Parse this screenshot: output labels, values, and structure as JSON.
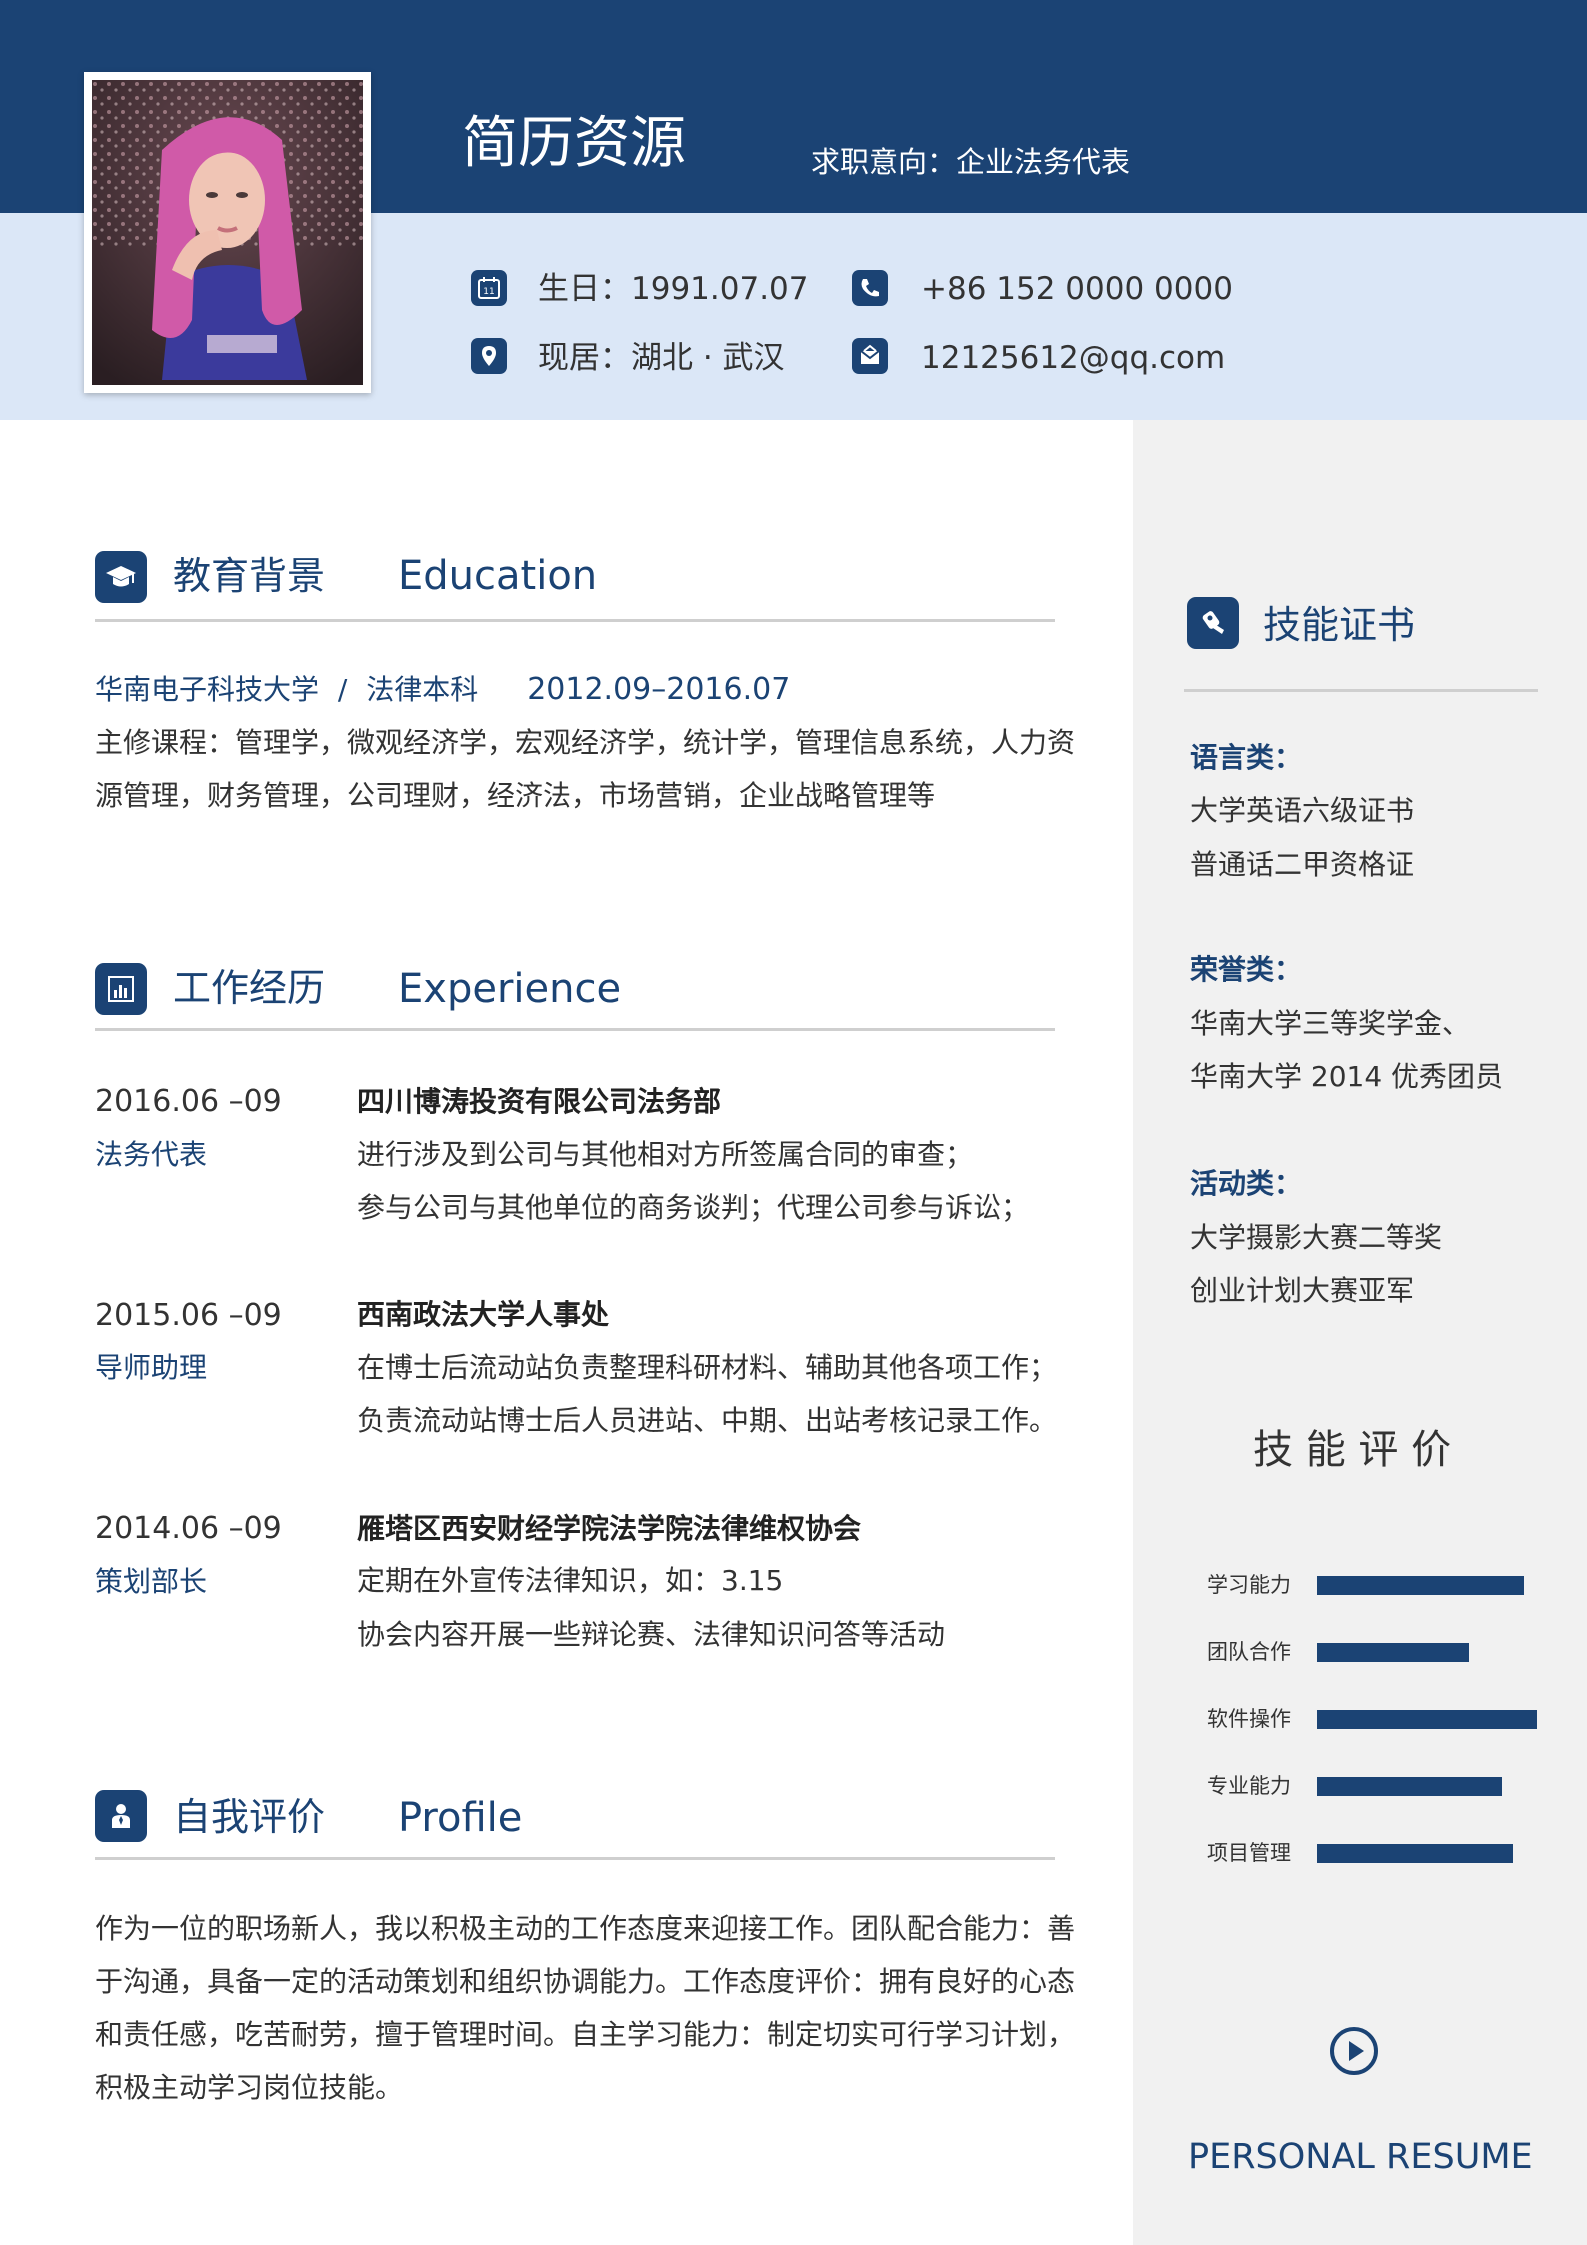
{
  "header": {
    "name": "简历资源",
    "intent": "求职意向：企业法务代表",
    "contacts": {
      "birthday": "生日：1991.07.07",
      "phone": "+86 152 0000 0000",
      "residence": "现居：湖北 · 武汉",
      "email": "12125612@qq.com"
    },
    "calendar_day": "11"
  },
  "education": {
    "title_zh": "教育背景",
    "title_en": "Education",
    "school": "华南电子科技大学",
    "separator": "/",
    "major": "法律本科",
    "period": "2012.09–2016.07",
    "courses_line1": "主修课程：管理学，微观经济学，宏观经济学，统计学，管理信息系统，人力资",
    "courses_line2": "源管理，财务管理，公司理财，经济法，市场营销，企业战略管理等"
  },
  "experience": {
    "title_zh": "工作经历",
    "title_en": "Experience",
    "items": [
      {
        "date": "2016.06 –09",
        "role": "法务代表",
        "org": "四川博涛投资有限公司法务部",
        "desc1": "进行涉及到公司与其他相对方所签属合同的审查；",
        "desc2": "参与公司与其他单位的商务谈判；代理公司参与诉讼；"
      },
      {
        "date": "2015.06 –09",
        "role": "导师助理",
        "org": "西南政法大学人事处",
        "desc1": "在博士后流动站负责整理科研材料、辅助其他各项工作；",
        "desc2": "负责流动站博士后人员进站、中期、出站考核记录工作。"
      },
      {
        "date": "2014.06 –09",
        "role": "策划部长",
        "org": "雁塔区西安财经学院法学院法律维权协会",
        "desc1": "定期在外宣传法律知识，如：3.15",
        "desc2": "协会内容开展一些辩论赛、法律知识问答等活动"
      }
    ]
  },
  "profile": {
    "title_zh": "自我评价",
    "title_en": "Profile",
    "lines": [
      "作为一位的职场新人，我以积极主动的工作态度来迎接工作。团队配合能力：善",
      "于沟通，具备一定的活动策划和组织协调能力。工作态度评价：拥有良好的心态",
      "和责任感，吃苦耐劳，擅于管理时间。自主学习能力：制定切实可行学习计划，",
      "积极主动学习岗位技能。"
    ]
  },
  "sidebar": {
    "certs_title": "技能证书",
    "groups": [
      {
        "category": "语言类：",
        "items": [
          "大学英语六级证书",
          "普通话二甲资格证"
        ]
      },
      {
        "category": "荣誉类：",
        "items": [
          "华南大学三等奖学金、",
          "华南大学 2014 优秀团员"
        ]
      },
      {
        "category": "活动类：",
        "items": [
          "大学摄影大赛二等奖",
          "创业计划大赛亚军"
        ]
      }
    ],
    "skills_title": "技 能 评 价",
    "skills": [
      {
        "label": "学习能力",
        "level": 0.94
      },
      {
        "label": "团队合作",
        "level": 0.69
      },
      {
        "label": "软件操作",
        "level": 1.0
      },
      {
        "label": "专业能力",
        "level": 0.84
      },
      {
        "label": "项目管理",
        "level": 0.89
      }
    ],
    "footer": "PERSONAL RESUME"
  },
  "colors": {
    "primary": "#1b4374",
    "header_light": "#dbe7f7",
    "sidebar_bg": "#f1f1f1",
    "divider": "#cfcfcf"
  },
  "icons": {
    "birthday": "calendar-icon",
    "phone": "phone-icon",
    "residence": "location-pin-icon",
    "email": "envelope-icon",
    "education": "graduation-cap-icon",
    "experience": "bar-chart-icon",
    "profile": "person-icon",
    "certs": "badge-icon",
    "footer": "play-circle-icon"
  }
}
